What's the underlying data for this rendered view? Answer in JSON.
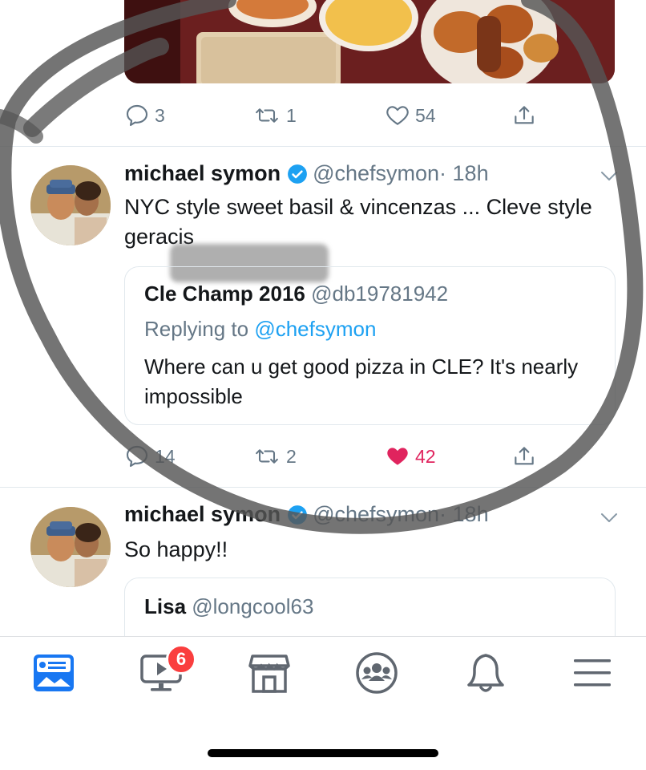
{
  "tweet0": {
    "stats": {
      "replies": "3",
      "retweets": "1",
      "likes": "54"
    }
  },
  "tweet1": {
    "author": {
      "name": "michael symon",
      "handle": "@chefsymon",
      "time": "· 18h"
    },
    "text": "NYC style sweet basil & vincenzas ... Cleve style geracis",
    "quote": {
      "name": "Cle Champ 2016",
      "handle": "@db19781942",
      "replying_prefix": "Replying to",
      "replying_to": "@chefsymon",
      "text": "Where can u get good pizza in CLE? It's nearly impossible"
    },
    "stats": {
      "replies": "14",
      "retweets": "2",
      "likes": "42"
    }
  },
  "tweet2": {
    "author": {
      "name": "michael symon",
      "handle": "@chefsymon",
      "time": "· 18h"
    },
    "text": "So happy!!",
    "quote": {
      "name": "Lisa",
      "handle": "@longcool63"
    }
  },
  "tabbar": {
    "items": [
      "news-feed",
      "watch",
      "marketplace",
      "groups",
      "notifications",
      "menu"
    ],
    "watch_badge": "6"
  },
  "colors": {
    "accent": "#1da1f2",
    "like": "#e0245e",
    "tab_active": "#1877f2",
    "badge": "#fa3e3e"
  }
}
